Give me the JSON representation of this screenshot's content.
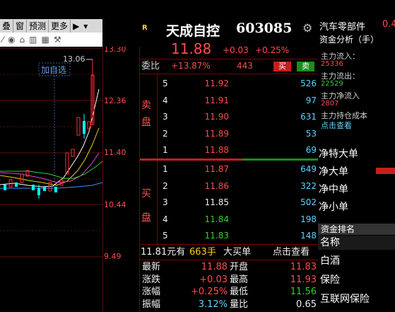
{
  "toolbar": {
    "items": [
      "叠",
      "窗",
      "预测",
      "更多"
    ],
    "prev_label": "▶"
  },
  "chart": {
    "add_watch_label": "加自选",
    "high_marker": "13.06",
    "price_labels": [
      "13.30",
      "12.36",
      "11.40",
      "10.44",
      "9.49"
    ]
  },
  "stock": {
    "r_badge": "R",
    "name": "天成自控",
    "code": "603085",
    "price": "11.88",
    "change": "+0.03",
    "change_pct": "+0.25%"
  },
  "weibi": {
    "label": "委比",
    "value": "+13.87%",
    "diff": "443",
    "buy_btn": "买",
    "sell_btn": "卖"
  },
  "sell_levels": [
    {
      "level": "5",
      "price": "11.92",
      "volume": "526"
    },
    {
      "level": "4",
      "price": "11.91",
      "volume": "97"
    },
    {
      "level": "3",
      "price": "11.90",
      "volume": "631"
    },
    {
      "level": "2",
      "price": "11.89",
      "volume": "53"
    },
    {
      "level": "1",
      "price": "11.88",
      "volume": "69"
    }
  ],
  "sell_label": [
    "卖",
    "盘"
  ],
  "buy_levels": [
    {
      "level": "1",
      "price": "11.87",
      "volume": "649"
    },
    {
      "level": "2",
      "price": "11.86",
      "volume": "322"
    },
    {
      "level": "3",
      "price": "11.85",
      "volume": "502"
    },
    {
      "level": "4",
      "price": "11.84",
      "volume": "198"
    },
    {
      "level": "5",
      "price": "11.83",
      "volume": "148"
    }
  ],
  "buy_label": [
    "买",
    "盘"
  ],
  "big_order": {
    "price": "11.81",
    "unit_text": "元有",
    "qty": "663手",
    "desc": "大买单",
    "link": "点击查看"
  },
  "quote": [
    {
      "l1": "最新",
      "v1": "11.88",
      "l2": "开盘",
      "v2": "11.83"
    },
    {
      "l1": "涨跌",
      "v1": "+0.03",
      "l2": "最高",
      "v2": "11.93"
    },
    {
      "l1": "涨幅",
      "v1": "+0.25%",
      "l2": "最低",
      "v2": "11.56"
    },
    {
      "l1": "振幅",
      "v1": "3.12%",
      "l2": "量比",
      "v2": "0.65"
    }
  ],
  "funds": {
    "sector": "汽车零部件",
    "sector_val": "0.4",
    "analysis_title": "资金分析（手）",
    "inflow_label": "主力流入：",
    "inflow_val": "25336",
    "outflow_label": "主力流出：",
    "outflow_val": "22529",
    "net_label": "主力净流入",
    "net_val": "2807",
    "cost_label": "主力持仓成本",
    "cost_link": "点击查看",
    "nets": [
      "净特大单",
      "净大单",
      "净中单",
      "净小单"
    ],
    "rank_title": "资金排名",
    "rank_header": "名称",
    "rank_items": [
      "白酒",
      "保险",
      "互联网保险"
    ]
  }
}
